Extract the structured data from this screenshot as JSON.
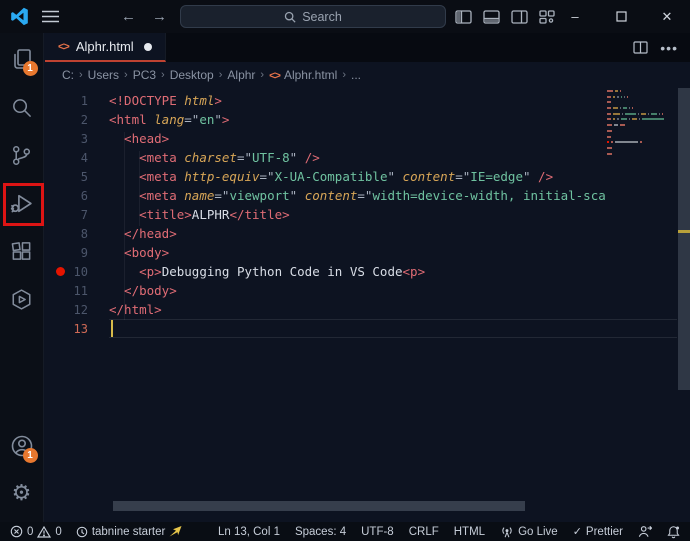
{
  "titlebar": {
    "search_placeholder": "Search",
    "window_controls": {
      "minimize": "–",
      "maximize": "▢",
      "close": "✕"
    }
  },
  "activity_bar": {
    "top_items": [
      {
        "name": "explorer",
        "icon": "files-icon",
        "badge": "1"
      },
      {
        "name": "search",
        "icon": "search-icon"
      },
      {
        "name": "source-control",
        "icon": "git-branch-icon"
      },
      {
        "name": "run-and-debug",
        "icon": "debug-icon",
        "highlighted": true
      },
      {
        "name": "extensions",
        "icon": "extensions-icon"
      },
      {
        "name": "live-preview",
        "icon": "hexagon-play-icon"
      }
    ],
    "bottom_items": [
      {
        "name": "accounts",
        "icon": "account-icon",
        "badge": "1"
      },
      {
        "name": "settings",
        "icon": "gear-icon"
      }
    ]
  },
  "tab_bar": {
    "tab_label": "Alphr.html",
    "modified": true,
    "tab_icon": "html-icon"
  },
  "breadcrumb": [
    "C:",
    "Users",
    "PC3",
    "Desktop",
    "Alphr",
    "Alphr.html",
    "..."
  ],
  "editor": {
    "active_line": 13,
    "breakpoint_lines": [
      10
    ],
    "lines": [
      {
        "tokens": [
          [
            "tg",
            "<!DOCTYPE "
          ],
          [
            "at",
            "html"
          ],
          [
            "tg",
            ">"
          ]
        ]
      },
      {
        "tokens": [
          [
            "tg",
            "<html "
          ],
          [
            "at",
            "lang"
          ],
          [
            "pn",
            "=\""
          ],
          [
            "st",
            "en"
          ],
          [
            "pn",
            "\""
          ],
          [
            "tg",
            ">"
          ]
        ]
      },
      {
        "tokens": [
          [
            "tg",
            "  <head>"
          ]
        ]
      },
      {
        "tokens": [
          [
            "tg",
            "    <meta "
          ],
          [
            "at",
            "charset"
          ],
          [
            "pn",
            "=\""
          ],
          [
            "st",
            "UTF-8"
          ],
          [
            "pn",
            "\" "
          ],
          [
            "tg",
            "/>"
          ]
        ]
      },
      {
        "tokens": [
          [
            "tg",
            "    <meta "
          ],
          [
            "at",
            "http-equiv"
          ],
          [
            "pn",
            "=\""
          ],
          [
            "st",
            "X-UA-Compatible"
          ],
          [
            "pn",
            "\" "
          ],
          [
            "at",
            "content"
          ],
          [
            "pn",
            "=\""
          ],
          [
            "st",
            "IE=edge"
          ],
          [
            "pn",
            "\" "
          ],
          [
            "tg",
            "/>"
          ]
        ]
      },
      {
        "tokens": [
          [
            "tg",
            "    <meta "
          ],
          [
            "at",
            "name"
          ],
          [
            "pn",
            "=\""
          ],
          [
            "st",
            "viewport"
          ],
          [
            "pn",
            "\" "
          ],
          [
            "at",
            "content"
          ],
          [
            "pn",
            "=\""
          ],
          [
            "st",
            "width=device-width, initial-sca"
          ]
        ]
      },
      {
        "tokens": [
          [
            "tg",
            "    <title>"
          ],
          [
            "tx",
            "ALPHR"
          ],
          [
            "tg",
            "</title>"
          ]
        ]
      },
      {
        "tokens": [
          [
            "tg",
            "  </head>"
          ]
        ]
      },
      {
        "tokens": [
          [
            "tg",
            "  <body>"
          ]
        ]
      },
      {
        "tokens": [
          [
            "tg",
            "    <p>"
          ],
          [
            "tx",
            "Debugging Python Code in VS Code"
          ],
          [
            "tg",
            "<p>"
          ]
        ]
      },
      {
        "tokens": [
          [
            "tg",
            "  </body>"
          ]
        ]
      },
      {
        "tokens": [
          [
            "tg",
            "</html>"
          ]
        ]
      },
      {
        "tokens": []
      }
    ]
  },
  "status_bar": {
    "left": [
      {
        "name": "problems",
        "segments": [
          {
            "icon": "error-icon"
          },
          {
            "text": "0"
          },
          {
            "icon": "warning-icon"
          },
          {
            "text": "0"
          }
        ]
      },
      {
        "name": "tabnine",
        "segments": [
          {
            "icon": "tabnine-icon"
          },
          {
            "text": "tabnine starter"
          },
          {
            "icon": "pointer-icon"
          }
        ]
      }
    ],
    "right": [
      {
        "name": "cursor-position",
        "text": "Ln 13, Col 1"
      },
      {
        "name": "indentation",
        "text": "Spaces: 4"
      },
      {
        "name": "encoding",
        "text": "UTF-8"
      },
      {
        "name": "eol",
        "text": "CRLF"
      },
      {
        "name": "language-mode",
        "text": "HTML"
      },
      {
        "name": "go-live",
        "icon": "broadcast-icon",
        "text": "Go Live"
      },
      {
        "name": "prettier",
        "icon": "check-icon",
        "text": "Prettier"
      },
      {
        "name": "feedback",
        "icon": "person-icon"
      },
      {
        "name": "notifications",
        "icon": "bell-icon"
      }
    ]
  },
  "colors": {
    "accent_annotation_box": "#dd1414",
    "badge": "#e8782f",
    "tab_underline": "#bf4231",
    "logo_blue": "#2aa9f2",
    "breakpoint": "#e51400",
    "cursor": "#d7ba4a",
    "token_tag": "#e06c75",
    "token_attr": "#d8a657",
    "token_string": "#6fc2a0",
    "pointer_yellow": "#e7c64a"
  }
}
